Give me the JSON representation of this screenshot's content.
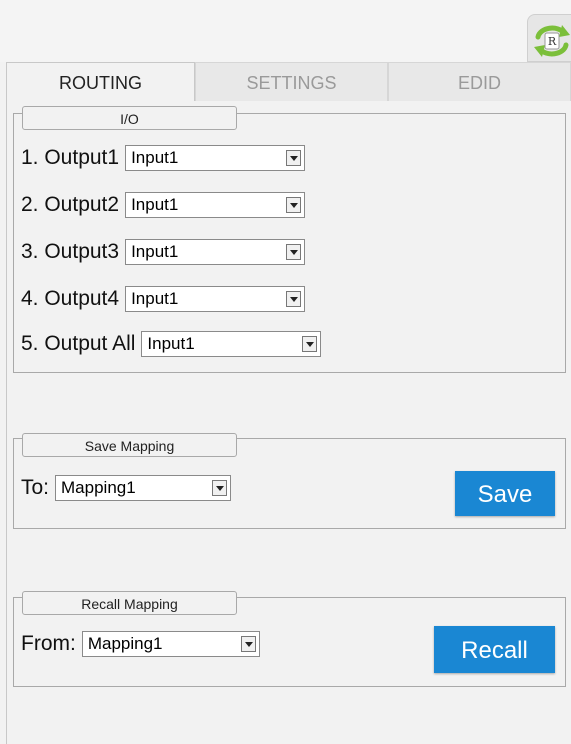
{
  "header": {
    "refresh_label": "R"
  },
  "tabs": [
    {
      "label": "ROUTING",
      "active": true
    },
    {
      "label": "SETTINGS",
      "active": false
    },
    {
      "label": "EDID",
      "active": false
    }
  ],
  "io": {
    "legend": "I/O",
    "rows": [
      {
        "label": "1. Output1",
        "value": "Input1"
      },
      {
        "label": "2. Output2",
        "value": "Input1"
      },
      {
        "label": "3. Output3",
        "value": "Input1"
      },
      {
        "label": "4. Output4",
        "value": "Input1"
      },
      {
        "label": "5. Output All",
        "value": "Input1"
      }
    ]
  },
  "save_mapping": {
    "legend": "Save Mapping",
    "label": "To:",
    "value": "Mapping1",
    "button": "Save"
  },
  "recall_mapping": {
    "legend": "Recall Mapping",
    "label": "From:",
    "value": "Mapping1",
    "button": "Recall"
  },
  "colors": {
    "accent": "#1a87d3",
    "background": "#f2f2f2"
  }
}
